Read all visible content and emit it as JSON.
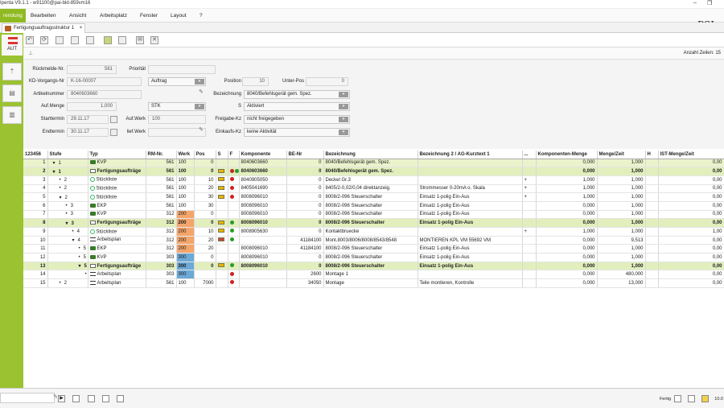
{
  "window": {
    "title": "Ipenta V9.1.1 - w91100@pai-bld-859vm16"
  },
  "menu": {
    "items": [
      "rendung",
      "Bearbeiten",
      "Ansicht",
      "Arbeitsplatz",
      "Fenster",
      "Layout",
      "?"
    ]
  },
  "brand": "PSI",
  "tab": {
    "label": "Fertigungsauftragsstruktur 1"
  },
  "sidebar": {
    "country": "AUT"
  },
  "subbar": {
    "row_count": "Anzahl Zeilen: 15"
  },
  "form": {
    "rueckmelde_label": "Rückmelde-Nr.",
    "rueckmelde_value": "561",
    "prioritaet_label": "Priorität",
    "prioritaet_value": "",
    "kd_label": "KD-Vorgangs-Nr",
    "kd_value": "K-16-00007",
    "auftrag_value": "Auftrag",
    "position_label": "Position",
    "position_value": "10",
    "unterpos_label": "Unter-Pos",
    "unterpos_value": "0",
    "artikel_label": "Artikelnummer",
    "artikel_value": "8040603660",
    "bezeichnung_label": "Bezeichnung",
    "bezeichnung_value": "8040/Befehlsgerät gem. Spez.",
    "aufmenge_label": "Auf.Menge",
    "aufmenge_value": "1,000",
    "einheit_value": "STK",
    "s_label": "S",
    "s_value": "Aktiviert",
    "starttermin_label": "Starttermin",
    "starttermin_value": "29.11.17",
    "aufwerk_label": "Auf.Werk",
    "aufwerk_value": "100",
    "freigabe_label": "Freigabe-Kz",
    "freigabe_value": "nicht freigegeben",
    "endtermin_label": "Endtermin",
    "endtermin_value": "30.11.17",
    "liefwerk_label": "lief.Werk",
    "liefwerk_value": "",
    "einkaufs_label": "Einkaufs-Kz",
    "einkaufs_value": "keine Aktivität"
  },
  "table": {
    "columns": [
      "123456",
      "Stufe",
      "Typ",
      "RM-Nr.",
      "Werk",
      "Pos",
      "S",
      "F",
      "Komponente",
      "BE-Nr",
      "Bezeichnung",
      "Bezeichnung 2 / AG-Kurztext 1",
      "...",
      "Komponenten-Menge",
      "Menge/Zeit",
      "H",
      "IST-Menge/Zeit"
    ],
    "rows": [
      {
        "n": "1",
        "tree": "▾",
        "stufe": "1",
        "icon": "truck",
        "typ": "KVP",
        "rm": "561",
        "werk": "100",
        "wc": "",
        "pos": "0",
        "s": "",
        "f": "",
        "komp": "8040603660",
        "be": "0",
        "bez": "8040/Befehlsgerät gem. Spez.",
        "bez2": "",
        "x": "",
        "km": "0,000",
        "mz": "1,000",
        "h": "",
        "ist": "0,00",
        "cls": "first"
      },
      {
        "n": "2",
        "tree": "▾",
        "stufe": "1",
        "icon": "folder",
        "typ": "Fertigungsaufträge",
        "rm": "561",
        "werk": "100",
        "wc": "",
        "pos": "0",
        "s": "y",
        "f": "rg",
        "komp": "8040603660",
        "be": "0",
        "bez": "8040/Befehlsgerät gem. Spez.",
        "bez2": "",
        "x": "",
        "km": "0,000",
        "mz": "1,000",
        "h": "",
        "ist": "0,00",
        "cls": "sel"
      },
      {
        "n": "3",
        "tree": "•",
        "stufe": "2",
        "icon": "list",
        "typ": "Stückliste",
        "rm": "561",
        "werk": "100",
        "wc": "",
        "pos": "10",
        "s": "y",
        "f": "r",
        "komp": "8040905050",
        "be": "0",
        "bez": "Deckel Gr.3",
        "bez2": "",
        "x": "+",
        "km": "1,000",
        "mz": "1,000",
        "h": "",
        "ist": "0,00",
        "cls": ""
      },
      {
        "n": "4",
        "tree": "•",
        "stufe": "2",
        "icon": "list",
        "typ": "Stückliste",
        "rm": "561",
        "werk": "100",
        "wc": "",
        "pos": "20",
        "s": "y",
        "f": "r",
        "komp": "8405041690",
        "be": "0",
        "bez": "8405/2-0,02/0,04 direktanzeig.",
        "bez2": "Strommesser 0-20mA o. Skala",
        "x": "+",
        "km": "1,000",
        "mz": "1,000",
        "h": "",
        "ist": "0,00",
        "cls": ""
      },
      {
        "n": "5",
        "tree": "▾",
        "stufe": "2",
        "icon": "list",
        "typ": "Stückliste",
        "rm": "561",
        "werk": "100",
        "wc": "",
        "pos": "30",
        "s": "y",
        "f": "r",
        "komp": "8008096010",
        "be": "0",
        "bez": "8008/2-096    Steuerschalter",
        "bez2": "Einsatz 1-polig Ein-Aus",
        "x": "+",
        "km": "1,000",
        "mz": "1,000",
        "h": "",
        "ist": "0,00",
        "cls": ""
      },
      {
        "n": "6",
        "tree": "•",
        "stufe": "3",
        "icon": "truck",
        "typ": "EKP",
        "rm": "561",
        "werk": "100",
        "wc": "",
        "pos": "30",
        "s": "",
        "f": "",
        "komp": "8008096010",
        "be": "0",
        "bez": "8008/2-096    Steuerschalter",
        "bez2": "Einsatz 1-polig Ein-Aus",
        "x": "",
        "km": "0,000",
        "mz": "1,000",
        "h": "",
        "ist": "0,00",
        "cls": ""
      },
      {
        "n": "7",
        "tree": "•",
        "stufe": "3",
        "icon": "truck",
        "typ": "KVP",
        "rm": "312",
        "werk": "200",
        "wc": "orange",
        "pos": "0",
        "s": "",
        "f": "",
        "komp": "8008096010",
        "be": "0",
        "bez": "8008/2-096    Steuerschalter",
        "bez2": "Einsatz 1-polig Ein-Aus",
        "x": "",
        "km": "0,000",
        "mz": "1,000",
        "h": "",
        "ist": "0,00",
        "cls": ""
      },
      {
        "n": "8",
        "tree": "▾",
        "stufe": "3",
        "icon": "folder",
        "typ": "Fertigungsaufträge",
        "rm": "312",
        "werk": "200",
        "wc": "orange",
        "pos": "0",
        "s": "y",
        "f": "g",
        "komp": "8008096010",
        "be": "0",
        "bez": "8008/2-096    Steuerschalter",
        "bez2": "Einsatz 1-polig Ein-Aus",
        "x": "",
        "km": "0,000",
        "mz": "1,000",
        "h": "",
        "ist": "0,00",
        "cls": "sel"
      },
      {
        "n": "9",
        "tree": "•",
        "stufe": "4",
        "icon": "list",
        "typ": "Stückliste",
        "rm": "312",
        "werk": "200",
        "wc": "orange",
        "pos": "10",
        "s": "y",
        "f": "g",
        "komp": "8008905630",
        "be": "0",
        "bez": "Kontaktbruecke",
        "bez2": "",
        "x": "+",
        "km": "1,000",
        "mz": "1,000",
        "h": "",
        "ist": "1,00",
        "cls": ""
      },
      {
        "n": "10",
        "tree": "▾",
        "stufe": "4",
        "icon": "plan",
        "typ": "Arbeitsplan",
        "rm": "312",
        "werk": "200",
        "wc": "orange",
        "pos": "20",
        "s": "r",
        "f": "g",
        "komp": "",
        "be": "41184100",
        "bez": "Mont.8003/8006/8008/8543/8548",
        "bez2": "MONTIEREN KPL VM 55692 VM",
        "x": "",
        "km": "0,000",
        "mz": "9,513",
        "h": "",
        "ist": "0,00",
        "cls": ""
      },
      {
        "n": "11",
        "tree": "•",
        "stufe": "5",
        "icon": "truck",
        "typ": "EKP",
        "rm": "312",
        "werk": "200",
        "wc": "orange",
        "pos": "20",
        "s": "",
        "f": "",
        "komp": "8008096010",
        "be": "41184100",
        "bez": "8008/2-096    Steuerschalter",
        "bez2": "Einsatz 1-polig Ein-Aus",
        "x": "",
        "km": "0,000",
        "mz": "1,000",
        "h": "",
        "ist": "0,00",
        "cls": ""
      },
      {
        "n": "12",
        "tree": "•",
        "stufe": "5",
        "icon": "truck",
        "typ": "KVP",
        "rm": "303",
        "werk": "300",
        "wc": "blue",
        "pos": "0",
        "s": "",
        "f": "",
        "komp": "8008096010",
        "be": "0",
        "bez": "8008/2-096    Steuerschalter",
        "bez2": "Einsatz 1-polig Ein-Aus",
        "x": "",
        "km": "0,000",
        "mz": "1,000",
        "h": "",
        "ist": "0,00",
        "cls": ""
      },
      {
        "n": "13",
        "tree": "▾",
        "stufe": "5",
        "icon": "folder",
        "typ": "Fertigungsaufträge",
        "rm": "303",
        "werk": "300",
        "wc": "blue",
        "pos": "0",
        "s": "y",
        "f": "g",
        "komp": "8008096010",
        "be": "0",
        "bez": "8008/2-096    Steuerschalter",
        "bez2": "Einsatz 1-polig Ein-Aus",
        "x": "",
        "km": "0,000",
        "mz": "1,000",
        "h": "",
        "ist": "0,00",
        "cls": "sel"
      },
      {
        "n": "14",
        "tree": "•",
        "stufe": "6",
        "icon": "plan",
        "typ": "Arbeitsplan",
        "rm": "303",
        "werk": "300",
        "wc": "blue",
        "pos": "",
        "s": "",
        "f": "r",
        "komp": "",
        "be": "2600",
        "bez": "Montage 1",
        "bez2": "",
        "x": "",
        "km": "0,000",
        "mz": "480,000",
        "h": "",
        "ist": "0,00",
        "cls": ""
      },
      {
        "n": "15",
        "tree": "•",
        "stufe": "2",
        "icon": "plan",
        "typ": "Arbeitsplan",
        "rm": "561",
        "werk": "100",
        "wc": "",
        "pos": "7000",
        "s": "",
        "f": "r",
        "komp": "",
        "be": "34050",
        "bez": "Montage",
        "bez2": "Teile montieren, Kontrolle",
        "x": "",
        "km": "0,000",
        "mz": "13,000",
        "h": "",
        "ist": "0,00",
        "cls": ""
      }
    ]
  },
  "status": {
    "text": "Fertig",
    "version": "10.0"
  }
}
